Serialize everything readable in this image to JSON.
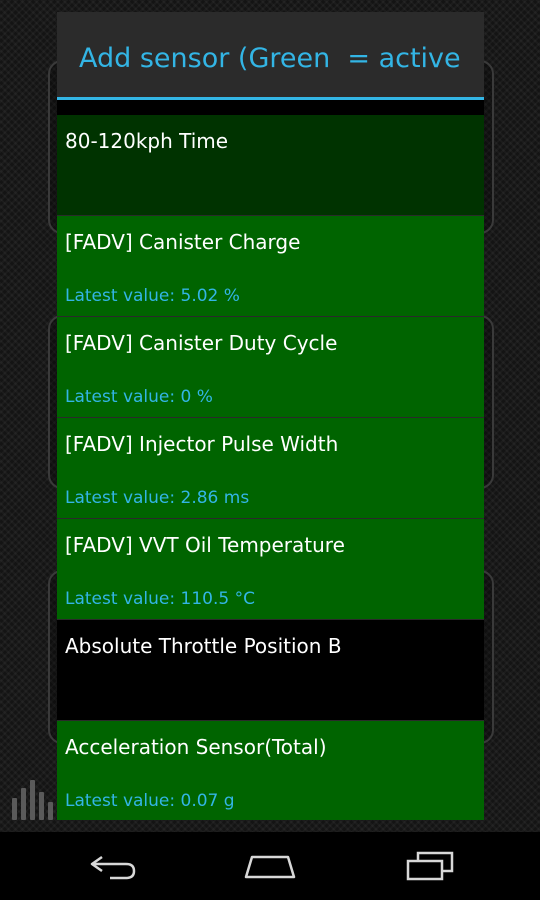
{
  "dialog": {
    "title": "Add sensor (Green  = active"
  },
  "sensors": [
    {
      "name": "80-120kph Time",
      "value": "",
      "state": "inactive-dark"
    },
    {
      "name": "[FADV] Canister Charge",
      "value": "Latest value: 5.02 %",
      "state": "active"
    },
    {
      "name": "[FADV] Canister Duty Cycle",
      "value": "Latest value: 0 %",
      "state": "active"
    },
    {
      "name": "[FADV] Injector Pulse Width",
      "value": "Latest value: 2.86 ms",
      "state": "active"
    },
    {
      "name": "[FADV] VVT Oil Temperature",
      "value": "Latest value: 110.5 °C",
      "state": "active"
    },
    {
      "name": "Absolute Throttle Position B",
      "value": "",
      "state": "inactive"
    },
    {
      "name": "Acceleration Sensor(Total)",
      "value": "Latest value: 0.07 g",
      "state": "active"
    }
  ],
  "nav": {
    "back_icon": "back-icon",
    "home_icon": "home-icon",
    "recents_icon": "recents-icon"
  },
  "colors": {
    "accent": "#33b5e5",
    "active": "#006400",
    "inactive_dark": "#003300",
    "inactive": "#000000"
  }
}
